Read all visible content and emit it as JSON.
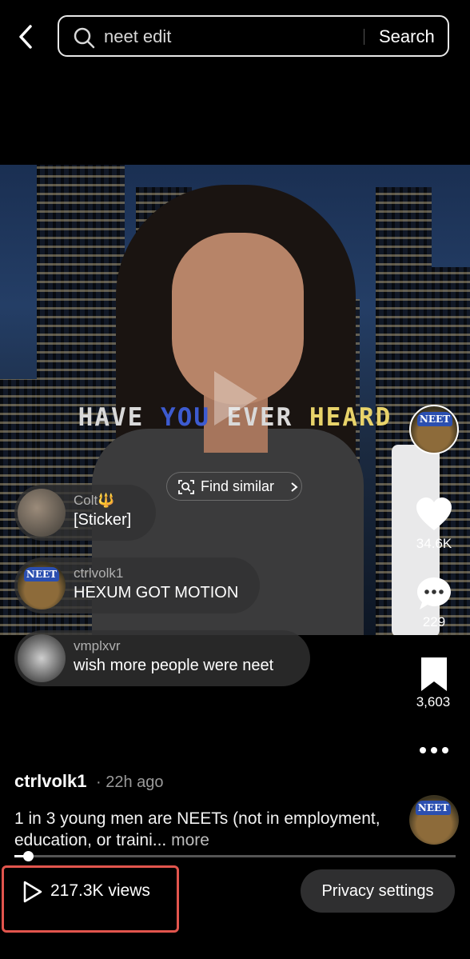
{
  "search": {
    "query": "neet edit",
    "button_label": "Search"
  },
  "video": {
    "caption_words": [
      "HAVE",
      "YOU",
      "EVER",
      "HEARD"
    ],
    "find_similar_label": "Find similar"
  },
  "comments": [
    {
      "user": "Colt🔱",
      "text": "[Sticker]"
    },
    {
      "user": "ctrlvolk1",
      "text": "HEXUM GOT MOTION"
    },
    {
      "user": "vmplxvr",
      "text": "wish more people were neet"
    }
  ],
  "rail": {
    "likes": "34.6K",
    "comments": "229",
    "saves": "3,603"
  },
  "post": {
    "author": "ctrlvolk1",
    "time_ago": "· 22h ago",
    "description": "1 in 3 young men are NEETs (not in employment, education, or traini...",
    "more_label": "more"
  },
  "playback_progress": 0.03,
  "footer": {
    "views": "217.3K views",
    "privacy_label": "Privacy settings"
  },
  "colors": {
    "highlight_box": "#e2554d",
    "caption_blue": "#3d5bd0",
    "caption_yellow": "#e8d36a"
  }
}
